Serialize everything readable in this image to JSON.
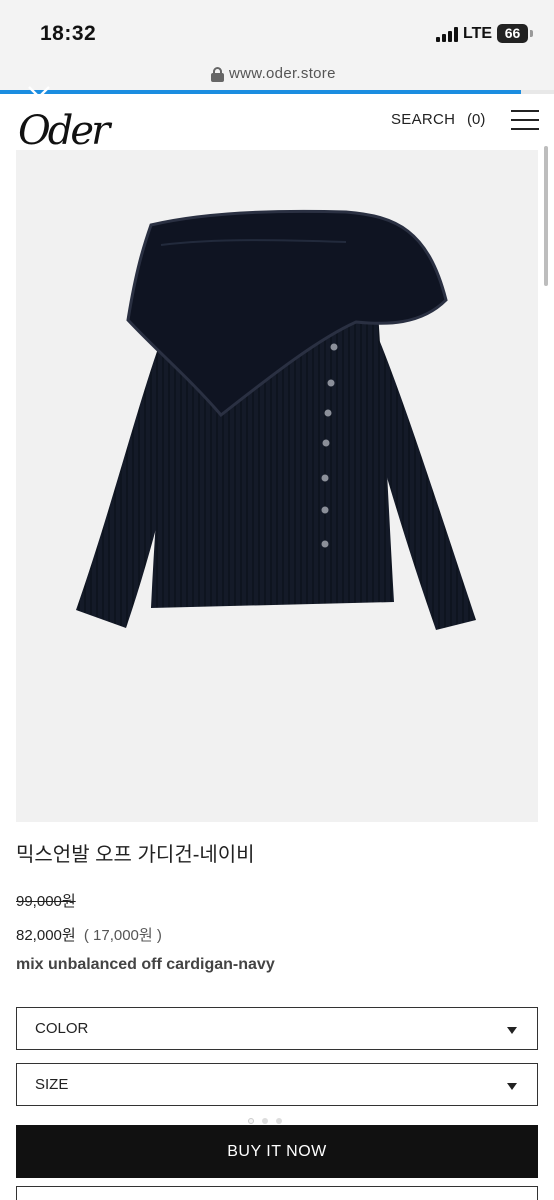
{
  "status_bar": {
    "time": "18:32",
    "network": "LTE",
    "battery": "66"
  },
  "browser": {
    "url": "www.oder.store",
    "load_progress": 0.94
  },
  "header": {
    "logo_text": "Oder",
    "search_label": "SEARCH",
    "cart_count": "(0)"
  },
  "product": {
    "image_desc_icon": "cardigan-image",
    "name": "믹스언발 오프 가디건-네이비",
    "price_original": "99,000원",
    "price_sale": "82,000원",
    "price_discount": "( 17,000원 )",
    "subtitle": "mix unbalanced off cardigan-navy"
  },
  "options": {
    "color_label": "COLOR",
    "size_label": "SIZE"
  },
  "buy_button_label": "BUY IT NOW",
  "colors": {
    "accent": "#1b8de0",
    "button_bg": "#111111",
    "garment": "#131826"
  }
}
